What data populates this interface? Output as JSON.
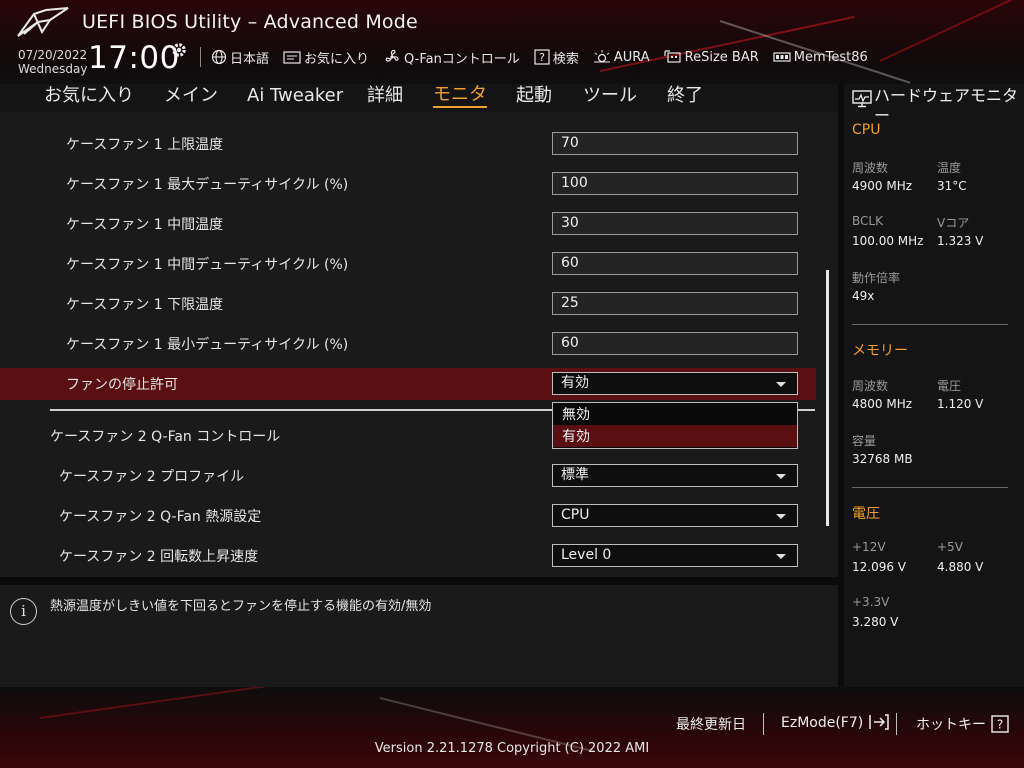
{
  "header": {
    "title": "UEFI BIOS Utility – Advanced Mode",
    "date": "07/20/2022",
    "weekday": "Wednesday",
    "time": "17:00",
    "toolbar": {
      "language": "日本語",
      "favorites": "お気に入り",
      "qfan": "Q-Fanコントロール",
      "search": "検索",
      "aura": "AURA",
      "resizebar": "ReSize BAR",
      "memtest": "MemTest86"
    }
  },
  "tabs": [
    "お気に入り",
    "メイン",
    "Ai Tweaker",
    "詳細",
    "モニタ",
    "起動",
    "ツール",
    "終了"
  ],
  "active_tab": "モニタ",
  "settings": [
    {
      "label": "ケースファン 1 上限温度",
      "value": "70"
    },
    {
      "label": "ケースファン 1 最大デューティサイクル (%)",
      "value": "100"
    },
    {
      "label": "ケースファン 1 中間温度",
      "value": "30"
    },
    {
      "label": "ケースファン 1 中間デューティサイクル (%)",
      "value": "60"
    },
    {
      "label": "ケースファン 1 下限温度",
      "value": "25"
    },
    {
      "label": "ケースファン 1 最小デューティサイクル (%)",
      "value": "60"
    },
    {
      "label": "ファンの停止許可",
      "value": "有効"
    },
    {
      "label": "ケースファン 2 Q-Fan コントロール"
    },
    {
      "label": "ケースファン 2 プロファイル",
      "value": "標準"
    },
    {
      "label": "ケースファン 2 Q-Fan 熱源設定",
      "value": "CPU"
    },
    {
      "label": "ケースファン 2 回転数上昇速度",
      "value": "Level 0"
    }
  ],
  "dropdown_options": [
    "無効",
    "有効"
  ],
  "dropdown_selected": "有効",
  "help_text": "熱源温度がしきい値を下回るとファンを停止する機能の有効/無効",
  "monitor": {
    "title": "ハードウェアモニター",
    "cpu": {
      "title": "CPU",
      "freq_label": "周波数",
      "freq": "4900 MHz",
      "temp_label": "温度",
      "temp": "31°C",
      "bclk_label": "BCLK",
      "bclk": "100.00 MHz",
      "vcore_label": "Vコア",
      "vcore": "1.323 V",
      "ratio_label": "動作倍率",
      "ratio": "49x"
    },
    "memory": {
      "title": "メモリー",
      "freq_label": "周波数",
      "freq": "4800 MHz",
      "volt_label": "電圧",
      "volt": "1.120 V",
      "cap_label": "容量",
      "cap": "32768 MB"
    },
    "voltage": {
      "title": "電圧",
      "v12_label": "+12V",
      "v12": "12.096 V",
      "v5_label": "+5V",
      "v5": "4.880 V",
      "v33_label": "+3.3V",
      "v33": "3.280 V"
    }
  },
  "footer": {
    "last_modified": "最終更新日",
    "ezmode": "EzMode(F7)",
    "hotkeys": "ホットキー",
    "version": "Version 2.21.1278 Copyright (C) 2022 AMI"
  },
  "colors": {
    "accent": "#f0a030",
    "highlight": "#5a0f13",
    "brand_red": "#c0141e"
  }
}
